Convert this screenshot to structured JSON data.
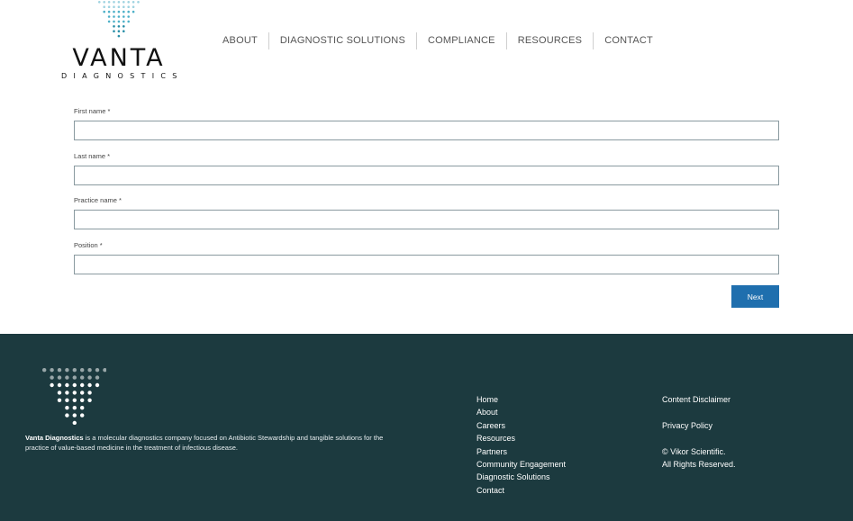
{
  "brand": {
    "name": "VANTA",
    "tagline": "DIAGNOSTICS",
    "accent_color": "#2a8fa8",
    "dark_color": "#1c3a3f"
  },
  "nav": {
    "items": [
      "ABOUT",
      "DIAGNOSTIC SOLUTIONS",
      "COMPLIANCE",
      "RESOURCES",
      "CONTACT"
    ]
  },
  "form": {
    "fields": [
      {
        "label": "First name *",
        "value": ""
      },
      {
        "label": "Last name *",
        "value": ""
      },
      {
        "label": "Practice name *",
        "value": ""
      },
      {
        "label": "Position *",
        "value": ""
      }
    ],
    "next_label": "Next",
    "button_color": "#1f6fae"
  },
  "footer": {
    "company_name": "Vanta Diagnostics",
    "description": " is a molecular diagnostics company focused on Antibiotic Stewardship and tangible solutions for the practice of value-based medicine in the treatment of infectious disease.",
    "links": [
      "Home",
      "About",
      "Careers",
      "Resources",
      "Partners",
      "Community Engagement",
      "Diagnostic Solutions",
      "Contact"
    ],
    "legal": {
      "disclaimer": "Content Disclaimer",
      "privacy": "Privacy Policy",
      "copyright_line1": "© Vikor Scientific.",
      "copyright_line2": "All Rights Reserved."
    }
  }
}
